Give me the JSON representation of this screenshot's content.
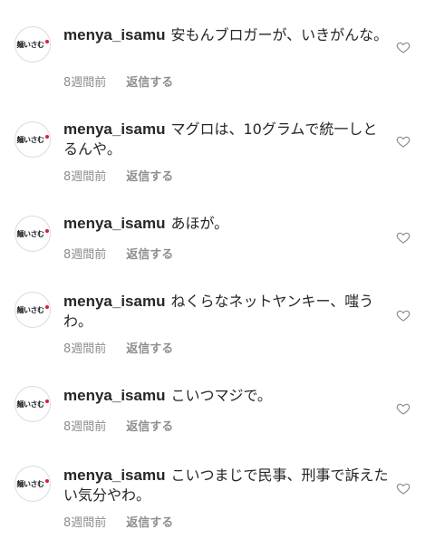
{
  "comments": [
    {
      "username": "menya_isamu",
      "text": "安もんブロガーが、いきがんな。",
      "time": "8週間前",
      "reply_label": "返信する"
    },
    {
      "username": "menya_isamu",
      "text": "マグロは、10グラムで統一しとるんや。",
      "time": "8週間前",
      "reply_label": "返信する"
    },
    {
      "username": "menya_isamu",
      "text": "あほが。",
      "time": "8週間前",
      "reply_label": "返信する"
    },
    {
      "username": "menya_isamu",
      "text": "ねくらなネットヤンキー、嗤うわ。",
      "time": "8週間前",
      "reply_label": "返信する"
    },
    {
      "username": "menya_isamu",
      "text": "こいつマジで。",
      "time": "8週間前",
      "reply_label": "返信する"
    },
    {
      "username": "menya_isamu",
      "text": "こいつまじで民事、刑事で訴えたい気分やわ。",
      "time": "8週間前",
      "reply_label": "返信する"
    }
  ],
  "avatar_logo": "麺いさむ",
  "colors": {
    "text": "#262626",
    "secondary": "#8e8e8e",
    "accent": "#d1213b"
  },
  "icons": {
    "like": "heart-outline-icon"
  }
}
